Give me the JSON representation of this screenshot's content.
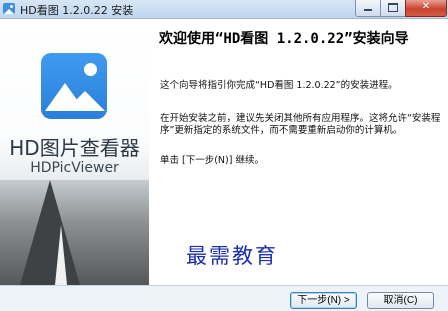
{
  "window": {
    "title": "HD看图 1.2.0.22 安装",
    "minimize_glyph": "",
    "maximize_glyph": "",
    "close_glyph": "✕"
  },
  "banner": {
    "title": "HD图片查看器",
    "subtitle": "HDPicViewer"
  },
  "content": {
    "heading": "欢迎使用“HD看图 1.2.0.22”安装向导",
    "paragraphs": [
      "这个向导将指引你完成“HD看图 1.2.0.22”的安装进程。",
      "在开始安装之前，建议先关闭其他所有应用程序。这将允许“安装程序”更新指定的系统文件，而不需要重新启动你的计算机。",
      "单击 [下一步(N)] 继续。"
    ]
  },
  "watermark": "最需教育",
  "buttons": {
    "next": "下一步(N) >",
    "cancel": "取消(C)"
  },
  "colors": {
    "accent": "#2b7fd9",
    "watermark": "#1c2fb0",
    "close": "#c8432f"
  },
  "icons": [
    "app-icon",
    "minimize-icon",
    "maximize-icon",
    "close-icon",
    "image-viewer-logo-icon"
  ]
}
